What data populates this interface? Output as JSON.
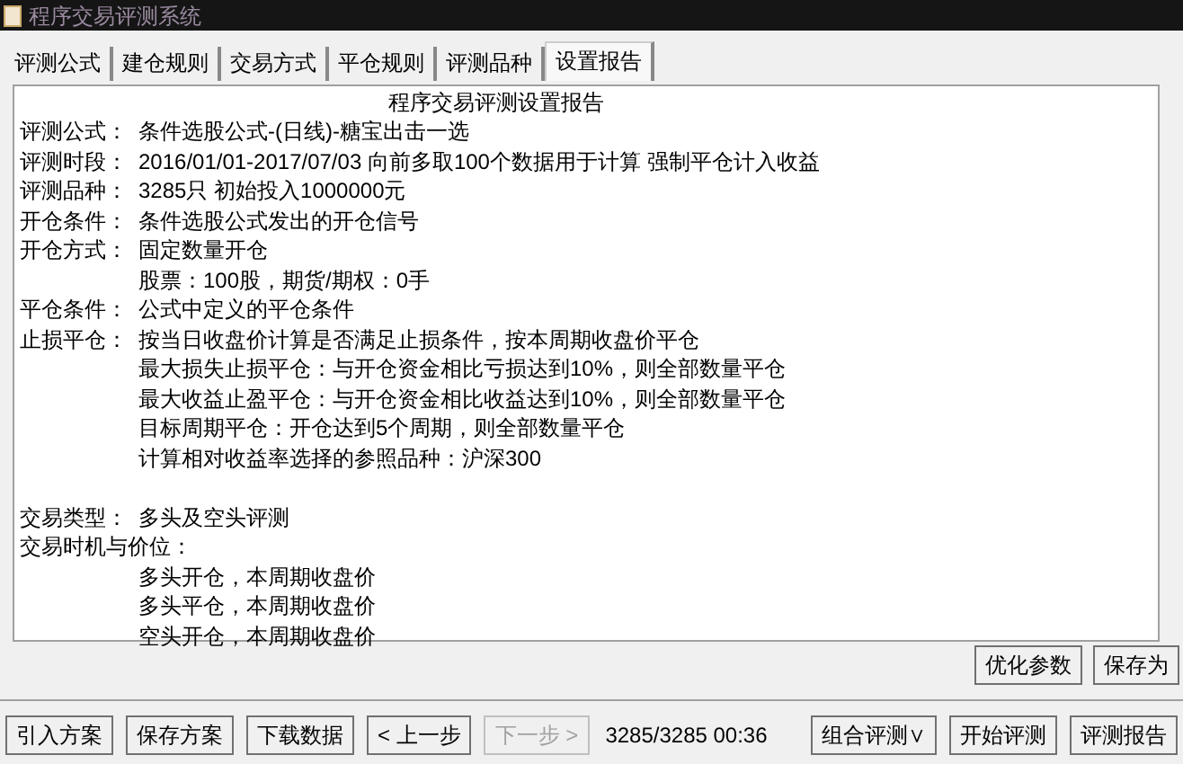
{
  "window": {
    "title": "程序交易评测系统"
  },
  "tabs": [
    {
      "label": "评测公式",
      "selected": false
    },
    {
      "label": "建仓规则",
      "selected": false
    },
    {
      "label": "交易方式",
      "selected": false
    },
    {
      "label": "平仓规则",
      "selected": false
    },
    {
      "label": "评测品种",
      "selected": false
    },
    {
      "label": "设置报告",
      "selected": true
    }
  ],
  "report": {
    "title": "程序交易评测设置报告",
    "lines": [
      {
        "kind": "field",
        "label": "评测公式：",
        "value": "条件选股公式-(日线)-糖宝出击一选"
      },
      {
        "kind": "field",
        "label": "评测时段：",
        "value": "2016/01/01-2017/07/03 向前多取100个数据用于计算 强制平仓计入收益"
      },
      {
        "kind": "field",
        "label": "评测品种：",
        "value": "3285只 初始投入1000000元"
      },
      {
        "kind": "field",
        "label": "开仓条件：",
        "value": "条件选股公式发出的开仓信号"
      },
      {
        "kind": "field",
        "label": "开仓方式：",
        "value": "固定数量开仓"
      },
      {
        "kind": "sub",
        "value": "股票：100股，期货/期权：0手"
      },
      {
        "kind": "field",
        "label": "平仓条件：",
        "value": "公式中定义的平仓条件"
      },
      {
        "kind": "field",
        "label": "止损平仓：",
        "value": "按当日收盘价计算是否满足止损条件，按本周期收盘价平仓"
      },
      {
        "kind": "sub",
        "value": "最大损失止损平仓：与开仓资金相比亏损达到10%，则全部数量平仓"
      },
      {
        "kind": "sub",
        "value": "最大收益止盈平仓：与开仓资金相比收益达到10%，则全部数量平仓"
      },
      {
        "kind": "sub",
        "value": "目标周期平仓：开仓达到5个周期，则全部数量平仓"
      },
      {
        "kind": "sub",
        "value": "计算相对收益率选择的参照品种：沪深300"
      },
      {
        "kind": "blank"
      },
      {
        "kind": "field",
        "label": "交易类型：",
        "value": "多头及空头评测"
      },
      {
        "kind": "heading",
        "label": "交易时机与价位："
      },
      {
        "kind": "sub",
        "value": "多头开仓，本周期收盘价"
      },
      {
        "kind": "sub",
        "value": "多头平仓，本周期收盘价"
      },
      {
        "kind": "sub",
        "value": "空头开仓，本周期收盘价"
      }
    ]
  },
  "panel_buttons": [
    {
      "label": "优化参数",
      "disabled": false
    },
    {
      "label": "保存为",
      "disabled": false
    }
  ],
  "toolbar": {
    "left_buttons": [
      {
        "label": "引入方案",
        "disabled": false
      },
      {
        "label": "保存方案",
        "disabled": false
      },
      {
        "label": "下载数据",
        "disabled": false
      },
      {
        "label": "< 上一步",
        "disabled": false
      },
      {
        "label": "下一步 >",
        "disabled": true
      }
    ],
    "status": "3285/3285 00:36",
    "right_buttons": [
      {
        "label": "组合评测∨",
        "disabled": false
      },
      {
        "label": "开始评测",
        "disabled": false
      },
      {
        "label": "评测报告",
        "disabled": false
      }
    ]
  }
}
